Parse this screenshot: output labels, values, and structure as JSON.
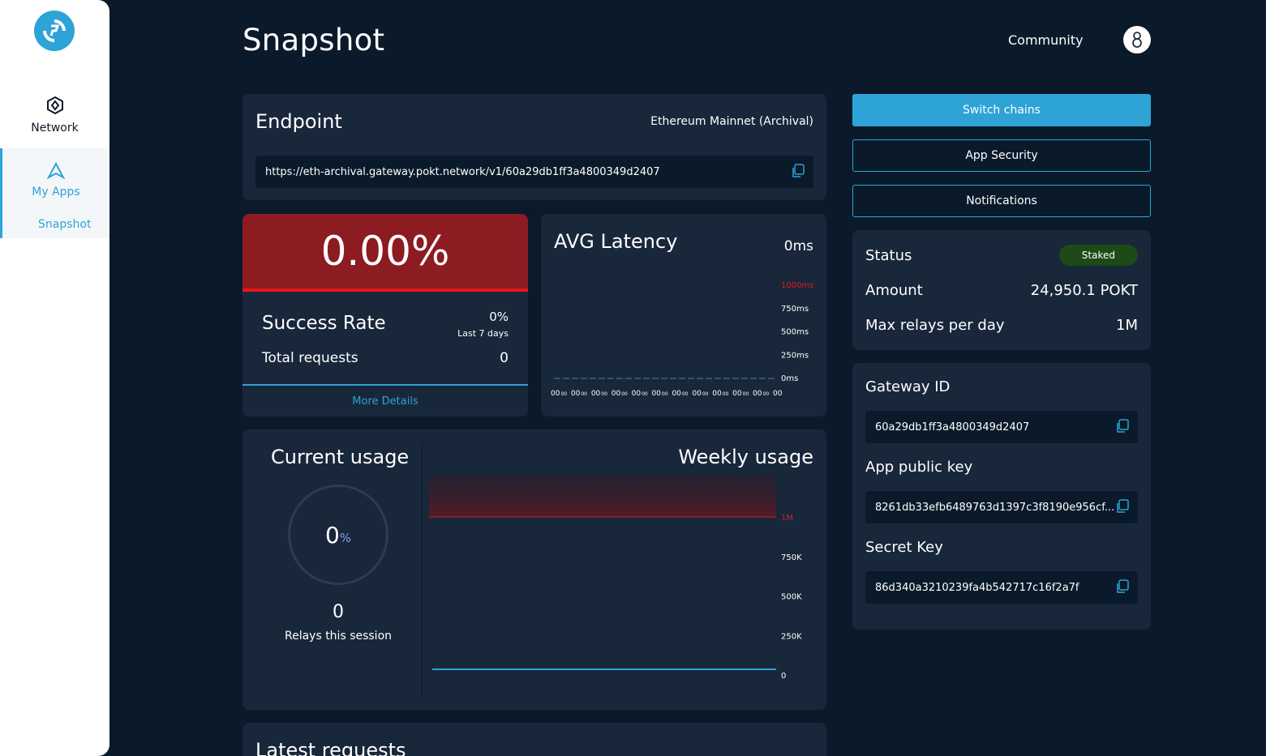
{
  "sidebar": {
    "items": [
      {
        "label": "Network",
        "icon": "network-icon"
      },
      {
        "label": "My Apps",
        "icon": "apps-icon"
      }
    ],
    "sub_item": "Snapshot"
  },
  "header": {
    "title": "Snapshot",
    "community": "Community"
  },
  "endpoint": {
    "title": "Endpoint",
    "chain": "Ethereum Mainnet (Archival)",
    "url": "https://eth-archival.gateway.pokt.network/v1/60a29db1ff3a4800349d2407"
  },
  "success_rate": {
    "value": "0.00%",
    "label": "Success Rate",
    "percent": "0%",
    "period": "Last 7 days",
    "total_label": "Total requests",
    "total": "0",
    "more": "More Details"
  },
  "latency": {
    "title": "AVG Latency",
    "value": "0ms",
    "y_ticks": [
      "1000ms",
      "750ms",
      "500ms",
      "250ms",
      "0ms"
    ],
    "x_tick_label": "00"
  },
  "usage": {
    "current_title": "Current usage",
    "percent": "0",
    "percent_unit": "%",
    "relays": "0",
    "relays_label": "Relays this session",
    "weekly_title": "Weekly usage",
    "y_ticks": [
      "1M",
      "750K",
      "500K",
      "250K",
      "0"
    ]
  },
  "actions": {
    "switch": "Switch chains",
    "security": "App Security",
    "notifications": "Notifications"
  },
  "status": {
    "status_label": "Status",
    "badge": "Staked",
    "amount_label": "Amount",
    "amount": "24,950.1 POKT",
    "max_label": "Max relays per day",
    "max": "1M"
  },
  "keys": {
    "gateway_label": "Gateway ID",
    "gateway": "60a29db1ff3a4800349d2407",
    "public_label": "App public key",
    "public": "8261db33efb6489763d1397c3f8190e956cf...",
    "secret_label": "Secret Key",
    "secret": "86d340a3210239fa4b542717c16f2a7f"
  },
  "latest": {
    "title": "Latest requests"
  },
  "chart_data": [
    {
      "type": "line",
      "title": "AVG Latency",
      "x": [
        "00",
        "00",
        "00",
        "00",
        "00",
        "00",
        "00",
        "00",
        "00",
        "00",
        "00",
        "00",
        "00",
        "00",
        "00",
        "00",
        "00",
        "00",
        "00",
        "00",
        "00",
        "00",
        "00"
      ],
      "values": [
        0,
        0,
        0,
        0,
        0,
        0,
        0,
        0,
        0,
        0,
        0,
        0,
        0,
        0,
        0,
        0,
        0,
        0,
        0,
        0,
        0,
        0,
        0
      ],
      "ylim": [
        0,
        1000
      ],
      "y_ticks": [
        "1000ms",
        "750ms",
        "500ms",
        "250ms",
        "0ms"
      ]
    },
    {
      "type": "line",
      "title": "Weekly usage",
      "values": [
        0,
        0
      ],
      "ylim": [
        0,
        1000000
      ],
      "y_ticks": [
        "1M",
        "750K",
        "500K",
        "250K",
        "0"
      ]
    }
  ],
  "colors": {
    "accent": "#2ea3d6",
    "danger": "#e8161e",
    "danger_bg": "#8c1b22",
    "badge": "#1d4a17"
  }
}
